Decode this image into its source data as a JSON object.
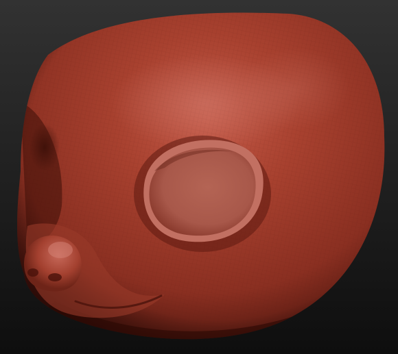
{
  "scene": {
    "subject": "sculpted-creature-head",
    "material_color": "#a8412f",
    "highlight_color": "#c9695a",
    "shadow_color": "#4a150d",
    "background_top": "#303030",
    "background_bottom": "#101010",
    "wireframe_visible": true
  }
}
